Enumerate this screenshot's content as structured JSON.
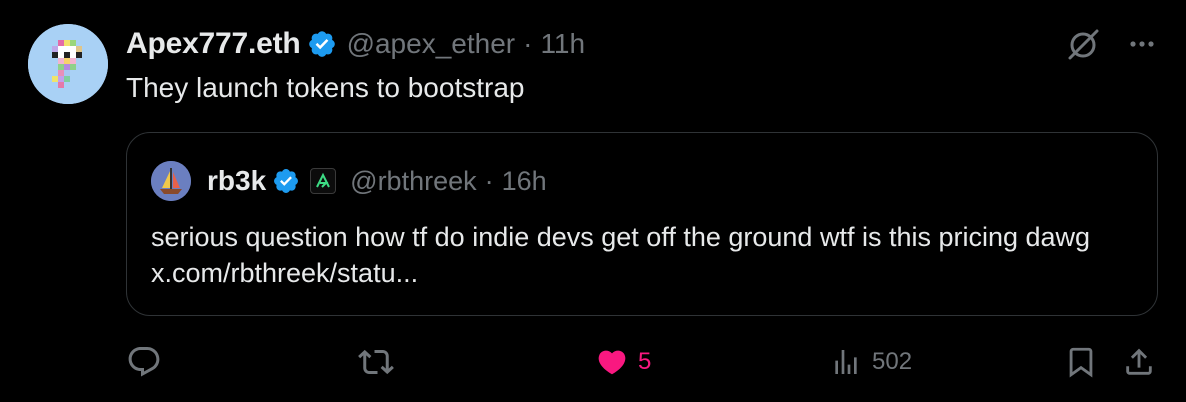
{
  "tweet": {
    "display_name": "Apex777.eth",
    "handle": "@apex_ether",
    "separator": "·",
    "time": "11h",
    "text": "They launch tokens to bootstrap",
    "verified_icon": "verified-badge-icon",
    "avatar_icon": "pixel-art-avatar"
  },
  "quote": {
    "display_name": "rb3k",
    "handle": "@rbthreek",
    "separator": "·",
    "time": "16h",
    "text": "serious question how tf do indie devs get off the ground wtf is this pricing dawg x.com/rbthreek/statu...",
    "affiliate_badge_icon": "affiliate-badge-icon"
  },
  "actions": {
    "reply": {
      "icon": "reply-icon",
      "count": ""
    },
    "repost": {
      "icon": "repost-icon",
      "count": ""
    },
    "like": {
      "icon": "heart-filled-icon",
      "count": "5",
      "liked": true
    },
    "views": {
      "icon": "views-icon",
      "count": "502"
    },
    "bookmark": {
      "icon": "bookmark-icon"
    },
    "share": {
      "icon": "share-icon"
    }
  },
  "colors": {
    "background": "#000000",
    "text_primary": "#e7e9ea",
    "text_secondary": "#71767b",
    "verified_blue": "#1d9bf0",
    "like_pink": "#f91880",
    "border": "#2f3336"
  }
}
